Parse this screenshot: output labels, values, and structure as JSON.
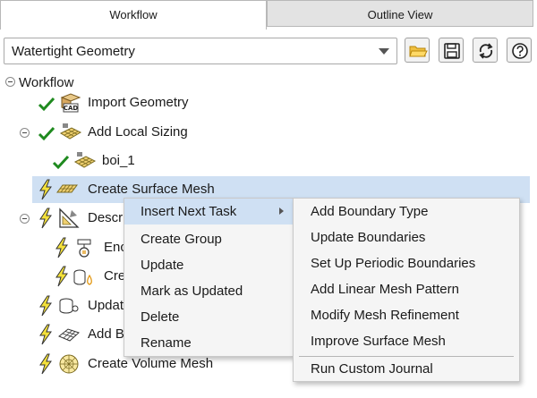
{
  "tabs": [
    {
      "label": "Workflow",
      "active": true
    },
    {
      "label": "Outline View",
      "active": false
    }
  ],
  "toolbar": {
    "workflow_select": "Watertight Geometry",
    "buttons": [
      {
        "icon": "folder-open-icon"
      },
      {
        "icon": "save-icon"
      },
      {
        "icon": "refresh-icon"
      },
      {
        "icon": "help-icon"
      }
    ]
  },
  "tree": {
    "root": "Workflow",
    "items": [
      {
        "label": "Import Geometry",
        "status": "done",
        "icon": "cad-icon"
      },
      {
        "label": "Add Local Sizing",
        "status": "done",
        "icon": "mesh-sizing-icon"
      },
      {
        "label": "boi_1",
        "status": "done",
        "icon": "mesh-sizing-icon"
      },
      {
        "label": "Create Surface Mesh",
        "status": "pending",
        "icon": "surface-mesh-icon"
      },
      {
        "label": "Descr",
        "status": "pending",
        "icon": "geometry-icon"
      },
      {
        "label": "Enc",
        "status": "pending",
        "icon": "enclose-icon"
      },
      {
        "label": "Cre",
        "status": "pending",
        "icon": "create-region-icon"
      },
      {
        "label": "Updat",
        "status": "pending",
        "icon": "update-icon"
      },
      {
        "label": "Add B",
        "status": "pending",
        "icon": "boundary-layer-icon"
      },
      {
        "label": "Create Volume Mesh",
        "status": "pending",
        "icon": "volume-mesh-icon"
      }
    ]
  },
  "context_menu": {
    "items": [
      "Insert Next Task",
      "Create Group",
      "Update",
      "Mark as Updated",
      "Delete",
      "Rename"
    ]
  },
  "submenu": {
    "items": [
      "Add Boundary Type",
      "Update Boundaries",
      "Set Up Periodic Boundaries",
      "Add Linear Mesh Pattern",
      "Modify Mesh Refinement",
      "Improve Surface Mesh"
    ],
    "extra": "Run Custom Journal"
  },
  "colors": {
    "accent_blue": "#cfe0f3",
    "check_green": "#1f8a1f",
    "bolt_yellow": "#f4e13b"
  }
}
